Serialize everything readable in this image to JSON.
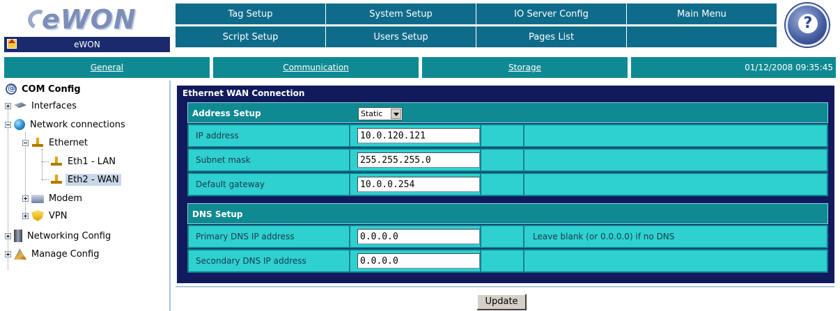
{
  "header": {
    "logo_text": "eWON",
    "home_label": "eWON"
  },
  "top_nav": {
    "row1": [
      "Tag Setup",
      "System Setup",
      "IO Server Config",
      "Main Menu"
    ],
    "row2": [
      "Script Setup",
      "Users Setup",
      "Pages List",
      ""
    ]
  },
  "sub_nav": {
    "tabs": [
      "General",
      "Communication",
      "Storage"
    ],
    "datetime": "01/12/2008 09:35:45"
  },
  "tree": {
    "root": "COM Config",
    "items": {
      "interfaces": "Interfaces",
      "network_connections": "Network connections",
      "ethernet": "Ethernet",
      "eth1": "Eth1 - LAN",
      "eth2": "Eth2 - WAN",
      "modem": "Modem",
      "vpn": "VPN",
      "networking_config": "Networking Config",
      "manage_config": "Manage Config"
    }
  },
  "panel": {
    "title": "Ethernet WAN Connection",
    "address_setup": {
      "label": "Address Setup",
      "mode": "Static"
    },
    "fields": {
      "ip_address": {
        "label": "IP address",
        "value": "10.0.120.121"
      },
      "subnet_mask": {
        "label": "Subnet mask",
        "value": "255.255.255.0"
      },
      "default_gateway": {
        "label": "Default gateway",
        "value": "10.0.0.254"
      }
    },
    "dns_setup": {
      "label": "DNS Setup",
      "primary": {
        "label": "Primary DNS IP address",
        "value": "0.0.0.0",
        "hint": "Leave blank (or 0.0.0.0) if no DNS"
      },
      "secondary": {
        "label": "Secondary DNS IP address",
        "value": "0.0.0.0"
      }
    }
  },
  "actions": {
    "update_label": "Update"
  }
}
